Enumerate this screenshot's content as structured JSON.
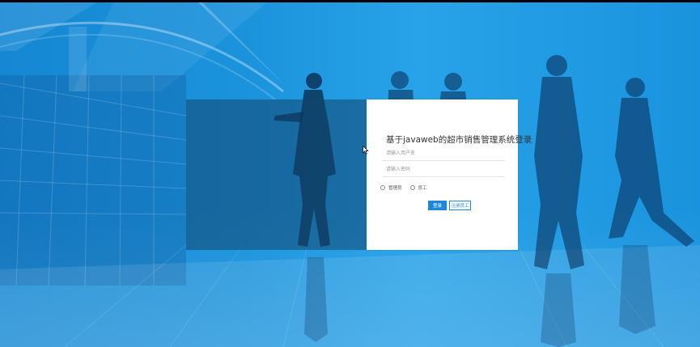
{
  "login": {
    "title": "基于javaweb的超市销售管理系统登录",
    "username_placeholder": "请输入用户名",
    "password_placeholder": "请输入密码",
    "roles": [
      {
        "label": "管理员",
        "selected": false
      },
      {
        "label": "员工",
        "selected": false
      }
    ],
    "login_button": "登录",
    "register_button": "注册员工"
  },
  "colors": {
    "background": "#1b8fd6",
    "primary": "#1e88d8",
    "card": "#ffffff",
    "overlay": "#12466e"
  }
}
